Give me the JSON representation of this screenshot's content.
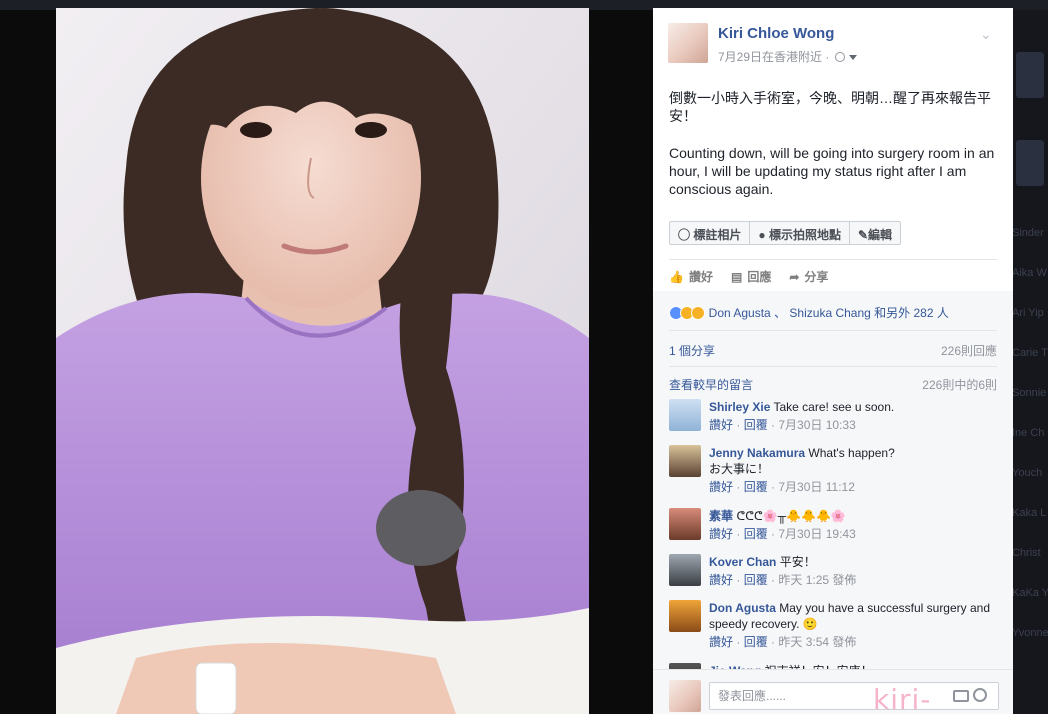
{
  "post": {
    "author": "Kiri Chloe Wong",
    "meta": "7月29日在香港附近 ·",
    "text_zh": "倒數一小時入手術室，今晚、明朝…醒了再來報告平安！",
    "text_en": "Counting down, will be going into surgery room in an hour, I will be updating my status right after I am conscious again."
  },
  "photo_tools": {
    "tag_photo": "標註相片",
    "add_location": "標示拍照地點",
    "edit": "編輯"
  },
  "actions": {
    "like": "讚好",
    "comment": "回應",
    "share": "分享"
  },
  "reactions": {
    "text_names_a": "Don Agusta",
    "separator": "、",
    "text_names_b": "Shizuka Chang",
    "text_others": "和另外 282 人"
  },
  "shares": {
    "count": "1 個分享",
    "comments_count": "226則回應"
  },
  "comments_header": {
    "view_earlier": "查看較早的留言",
    "counter": "226則中的6則"
  },
  "comments": [
    {
      "name": "Shirley Xie",
      "text": "Take care! see u soon.",
      "like": "讚好",
      "reply": "回覆",
      "time": "7月30日 10:33"
    },
    {
      "name": "Jenny Nakamura",
      "text": "What's happen?",
      "text2": "お大事に！",
      "like": "讚好",
      "reply": "回覆",
      "time": "7月30日 11:12"
    },
    {
      "name": "素華",
      "text": "ᕦᕦᕦ🌸╥🐥🐥🐥🌸",
      "like": "讚好",
      "reply": "回覆",
      "time": "7月30日 19:43"
    },
    {
      "name": "Kover Chan",
      "text": "平安！",
      "like": "讚好",
      "reply": "回覆",
      "time": "昨天 1:25 發佈"
    },
    {
      "name": "Don Agusta",
      "text": "May you have a successful surgery and speedy recovery. 🙂",
      "like": "讚好",
      "reply": "回覆",
      "time": "昨天 3:54 發佈"
    },
    {
      "name": "Jie Wang",
      "text": "祝吉祥！安！安康！"
    }
  ],
  "composer": {
    "placeholder": "發表回應......"
  },
  "watermark": "kiri-san.com",
  "background": {
    "names": [
      "Sinder",
      "Aika W",
      "Ari Yip",
      "Carie T",
      "Sonnie",
      "Ine Ch",
      "Youch",
      "Kaka L",
      "Christ",
      "KaKa Y",
      "Yvonne"
    ],
    "top_title": "Kiri Chloe Wong"
  },
  "colors": {
    "link": "#365899",
    "muted": "#90949c",
    "text": "#1d2129",
    "gown": "#b48ad8"
  }
}
